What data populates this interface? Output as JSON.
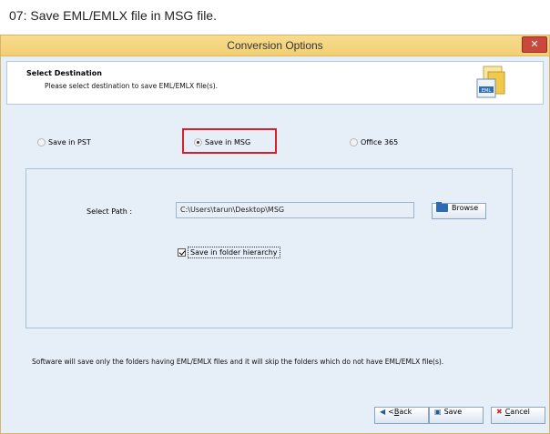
{
  "caption": "07: Save EML/EMLX file in MSG file.",
  "window": {
    "title": "Conversion Options",
    "close_symbol": "✕"
  },
  "header": {
    "title": "Select Destination",
    "description": "Please select destination to save EML/EMLX file(s).",
    "icon_text": "EML",
    "icon": "eml-file-icon"
  },
  "options": [
    {
      "label": "Save in PST",
      "selected": false
    },
    {
      "label": "Save in MSG",
      "selected": true
    },
    {
      "label": "Office 365",
      "selected": false
    }
  ],
  "path": {
    "label": "Select Path :",
    "value": "C:\\Users\\tarun\\Desktop\\MSG",
    "browse_label": "Browse",
    "browse_icon": "folder-open-icon"
  },
  "hierarchy_checkbox": {
    "label": "Save in folder hierarchy",
    "checked": true
  },
  "note": "Software will save only the folders having EML/EMLX files and it will skip the folders which do not have EML/EMLX file(s).",
  "buttons": {
    "back_symbol": "<",
    "back_key": "B",
    "back_rest": "ack",
    "save_label": "Save",
    "cancel_key": "C",
    "cancel_rest": "ancel"
  },
  "colors": {
    "titlebar": "#f2cf74",
    "highlight": "#d8202a",
    "window_bg": "#e6eef7"
  }
}
